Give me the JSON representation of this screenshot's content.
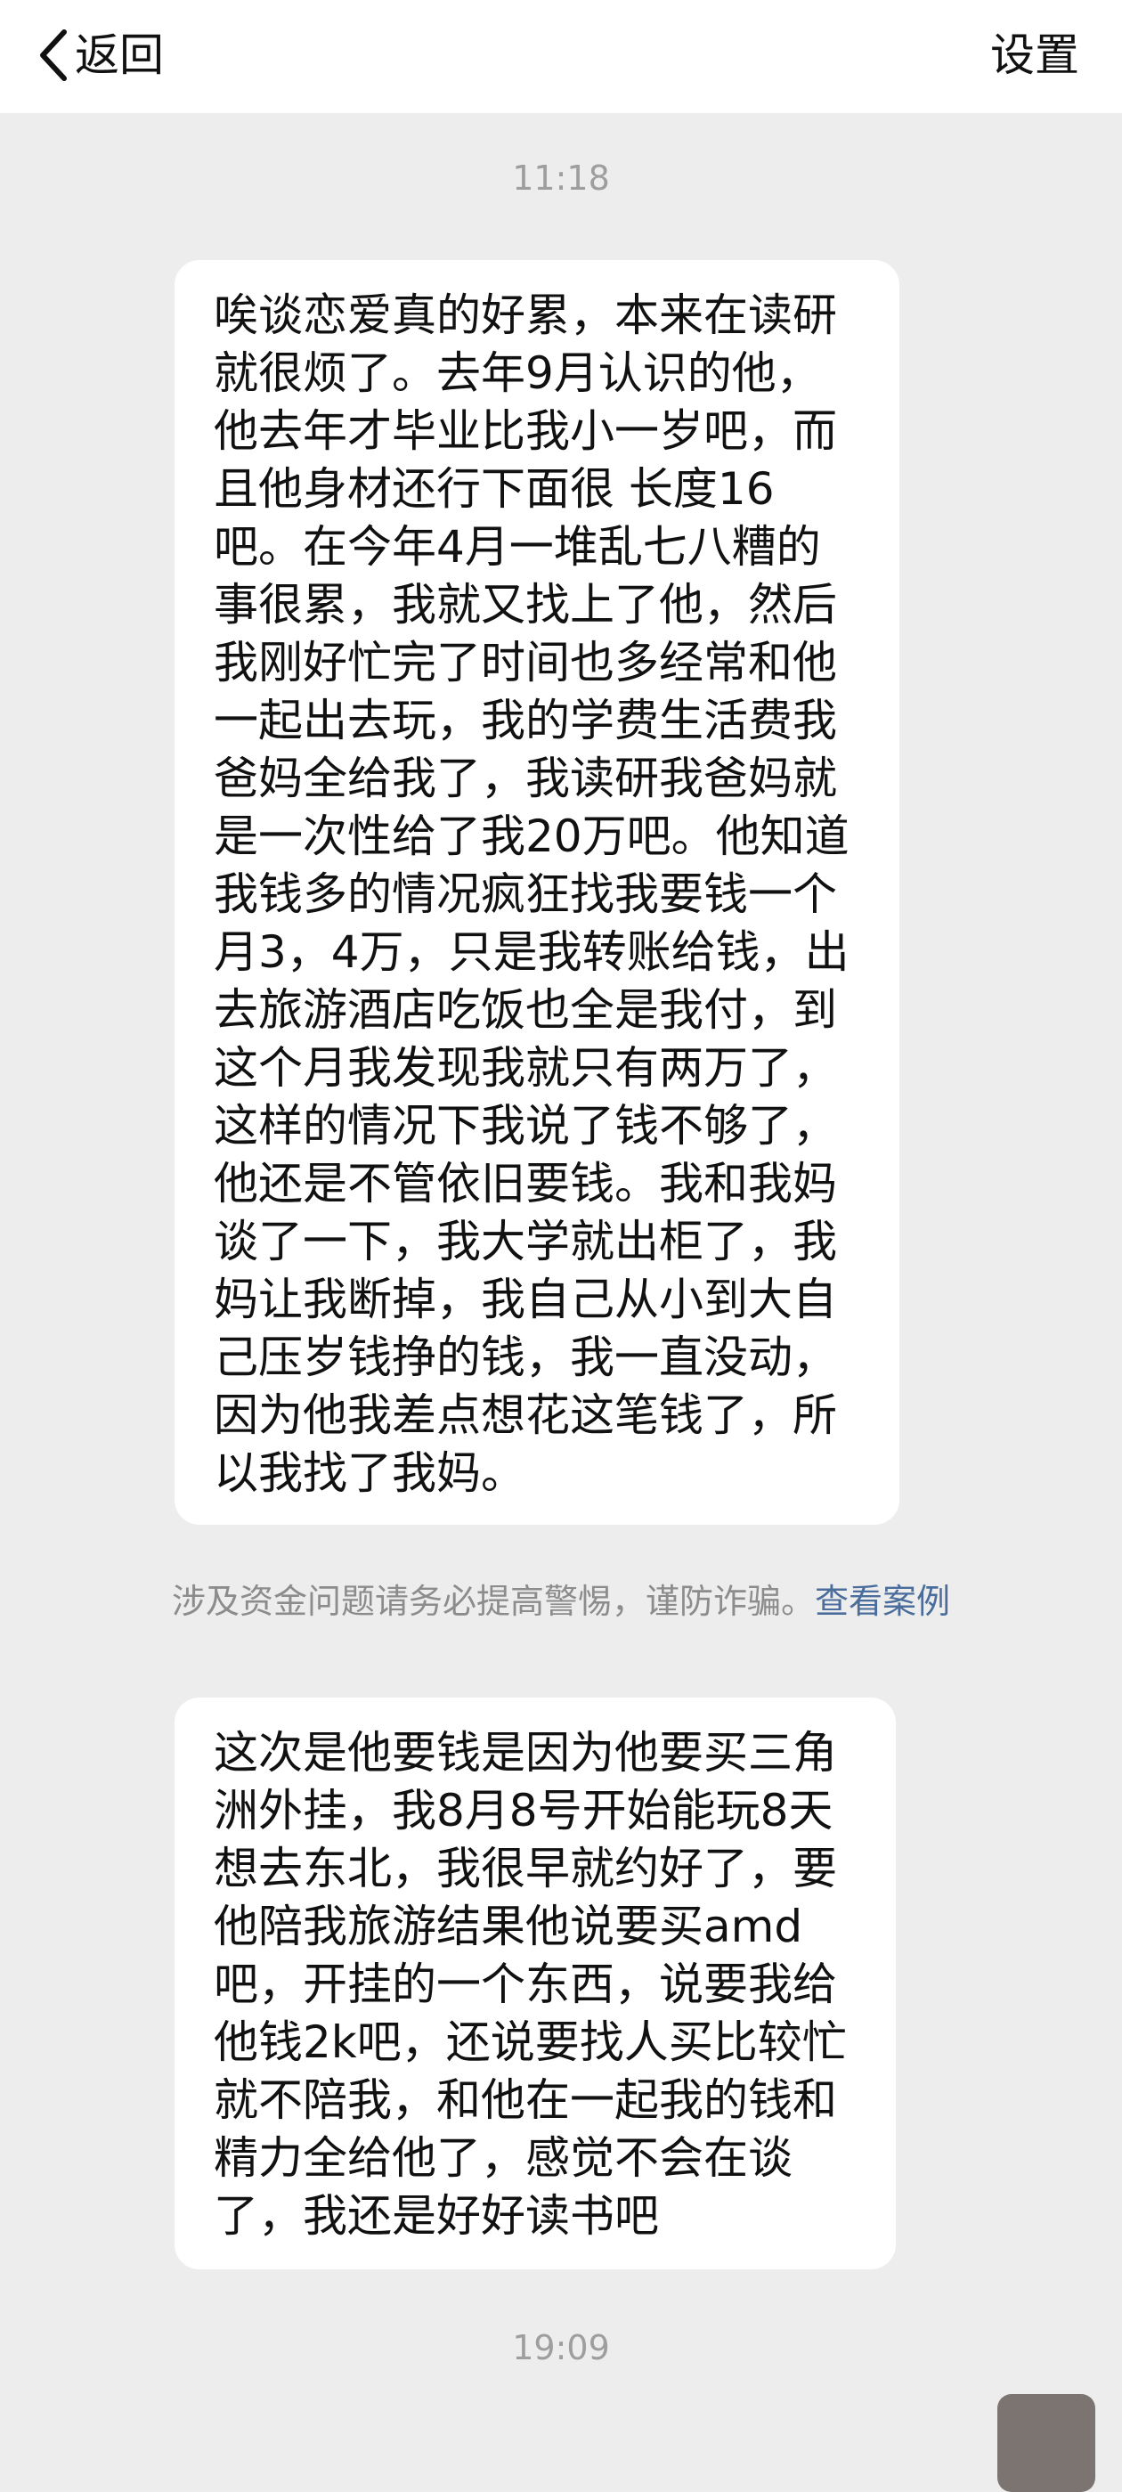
{
  "header": {
    "back_label": "返回",
    "settings_label": "设置"
  },
  "messages": [
    {
      "time": "11:18",
      "text": "唉谈恋爱真的好累，本来在读研\n就很烦了。去年9月认识的他，\n他去年才毕业比我小一岁吧，而\n且他身材还行下面很  长度16\n吧。在今年4月一堆乱七八糟的\n事很累，我就又找上了他，然后\n我刚好忙完了时间也多经常和他\n一起出去玩，我的学费生活费我\n爸妈全给我了，我读研我爸妈就\n是一次性给了我20万吧。他知道\n我钱多的情况疯狂找我要钱一个\n月3，4万，只是我转账给钱，出\n去旅游酒店吃饭也全是我付，到\n这个月我发现我就只有两万了，\n这样的情况下我说了钱不够了，\n他还是不管依旧要钱。我和我妈\n谈了一下，我大学就出柜了，我\n妈让我断掉，我自己从小到大自\n己压岁钱挣的钱，我一直没动，\n因为他我差点想花这笔钱了，所\n以我找了我妈。"
    },
    {
      "text": "这次是他要钱是因为他要买三角\n洲外挂，我8月8号开始能玩8天\n想去东北，我很早就约好了，要\n他陪我旅游结果他说要买amd\n吧，开挂的一个东西，说要我给\n他钱2k吧，还说要找人买比较忙\n就不陪我，和他在一起我的钱和\n精力全给他了，感觉不会在谈\n了，我还是好好读书吧"
    }
  ],
  "notice": {
    "text": "涉及资金问题请务必提高警惕，谨防诈骗。",
    "link": "查看案例"
  },
  "footer_time": "19:09",
  "colors": {
    "background": "#ededed",
    "bubble": "#ffffff",
    "link": "#4b6d9c",
    "timestamp": "#9e9e9e"
  }
}
